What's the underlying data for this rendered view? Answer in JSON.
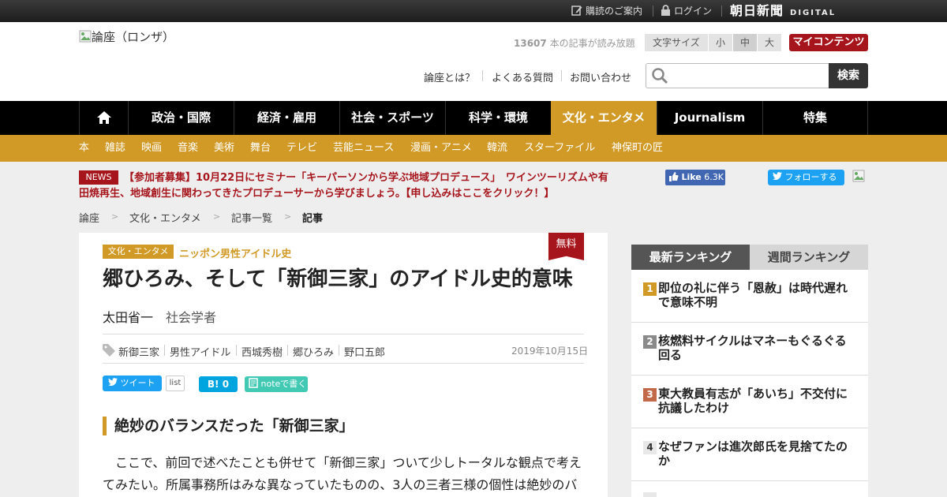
{
  "topbar": {
    "subscribe_label": "購読のご案内",
    "login_label": "ログイン",
    "brand_name": "朝日新聞",
    "brand_sub": "DIGITAL"
  },
  "header": {
    "logo_alt": "論座（ロンザ）",
    "article_count": "13607",
    "article_count_suffix": " 本の記事が読み放題",
    "font_size_label": "文字サイズ",
    "font_sizes": [
      "小",
      "中",
      "大"
    ],
    "my_content_label": "マイコンテンツ",
    "links": [
      "論座とは？",
      "よくある質問",
      "お問い合わせ"
    ],
    "search_placeholder": "",
    "search_button": "検索"
  },
  "nav": {
    "items": [
      "政治・国際",
      "経済・雇用",
      "社会・スポーツ",
      "科学・環境",
      "文化・エンタメ",
      "Journalism",
      "特集"
    ],
    "active_index": 4
  },
  "subnav": {
    "items": [
      "本",
      "雑誌",
      "映画",
      "音楽",
      "美術",
      "舞台",
      "テレビ",
      "芸能ニュース",
      "漫画・アニメ",
      "韓流",
      "スターファイル",
      "神保町の匠"
    ]
  },
  "news": {
    "badge": "NEWS",
    "line1": "【参加者募集】10月22日にセミナー「キーパーソンから学ぶ地域プロデュース」　ワインツーリズムや有",
    "line2": "田焼再生、地域創生に関わってきたプロデューサーから学びましょう。【申し込みはここをクリック！】"
  },
  "social": {
    "like_label": "Like",
    "like_count": "6.3K",
    "follow_label": "フォローする"
  },
  "breadcrumb": {
    "items": [
      "論座",
      "文化・エンタメ",
      "記事一覧",
      "記事"
    ],
    "separator": ">"
  },
  "article": {
    "category": "文化・エンタメ",
    "series": "ニッポン男性アイドル史",
    "free_badge": "無料",
    "title": "郷ひろみ、そして「新御三家」のアイドル史的意味",
    "author": "太田省一",
    "author_role": "社会学者",
    "tags": [
      "新御三家",
      "男性アイドル",
      "西城秀樹",
      "郷ひろみ",
      "野口五郎"
    ],
    "date": "2019年10月15日",
    "share": {
      "tweet_label": "ツイート",
      "list_label": "list",
      "hatena_count": "0",
      "note_label": "noteで書く"
    },
    "section_heading": "絶妙のバランスだった「新御三家」",
    "body_line1": "　ここで、前回で述べたことも併せて「新御三家」ついて少しトータルな観点で考え",
    "body_line2": "てみたい。所属事務所はみな異なっていたものの、3人の三者三様の個性は絶妙のバ"
  },
  "ranking": {
    "tabs": [
      "最新ランキング",
      "週間ランキング"
    ],
    "items": [
      {
        "rank": "1",
        "title": "即位の礼に伴う「恩赦」は時代遅れで意味不明"
      },
      {
        "rank": "2",
        "title": "核燃料サイクルはマネーもぐるぐる回る"
      },
      {
        "rank": "3",
        "title": "東大教員有志が「あいち」不交付に抗議したわけ"
      },
      {
        "rank": "4",
        "title": "なぜファンは進次郎氏を見捨てたのか"
      }
    ]
  },
  "colors": {
    "accent_gold": "#d19a26",
    "nav_black": "#000000",
    "news_red": "#a7151c",
    "my_content_red": "#a7151c",
    "twitter_blue": "#1da1f2",
    "facebook_blue": "#4267b2",
    "note_green": "#41c9b4",
    "hatena_blue": "#00a4de",
    "rank1": "#d19a26",
    "rank2": "#8a8a8a",
    "rank3": "#c2694a",
    "rank4": "#e8e8e8"
  }
}
